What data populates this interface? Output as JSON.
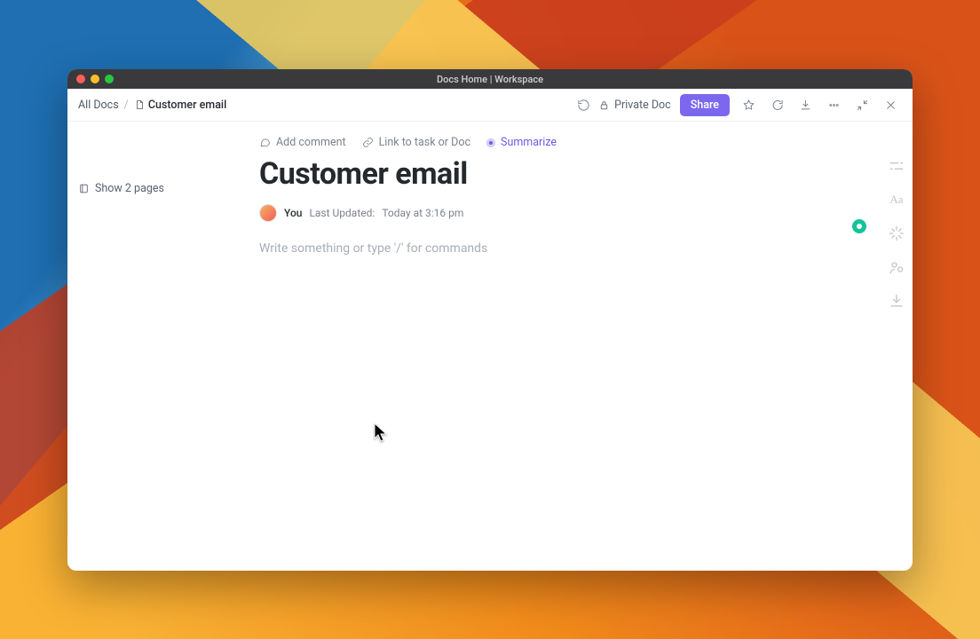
{
  "window": {
    "title": "Docs Home | Workspace"
  },
  "breadcrumb": {
    "root": "All Docs",
    "current": "Customer email"
  },
  "toolbar": {
    "privacy_label": "Private Doc",
    "share_label": "Share"
  },
  "sidebar": {
    "show_pages_label": "Show 2 pages"
  },
  "doc_actions": {
    "add_comment": "Add comment",
    "link_task": "Link to task or Doc",
    "summarize": "Summarize"
  },
  "doc": {
    "title": "Customer email",
    "author": "You",
    "last_updated_label": "Last Updated:",
    "last_updated_value": "Today at 3:16 pm",
    "editor_placeholder": "Write something or type '/' for commands"
  }
}
